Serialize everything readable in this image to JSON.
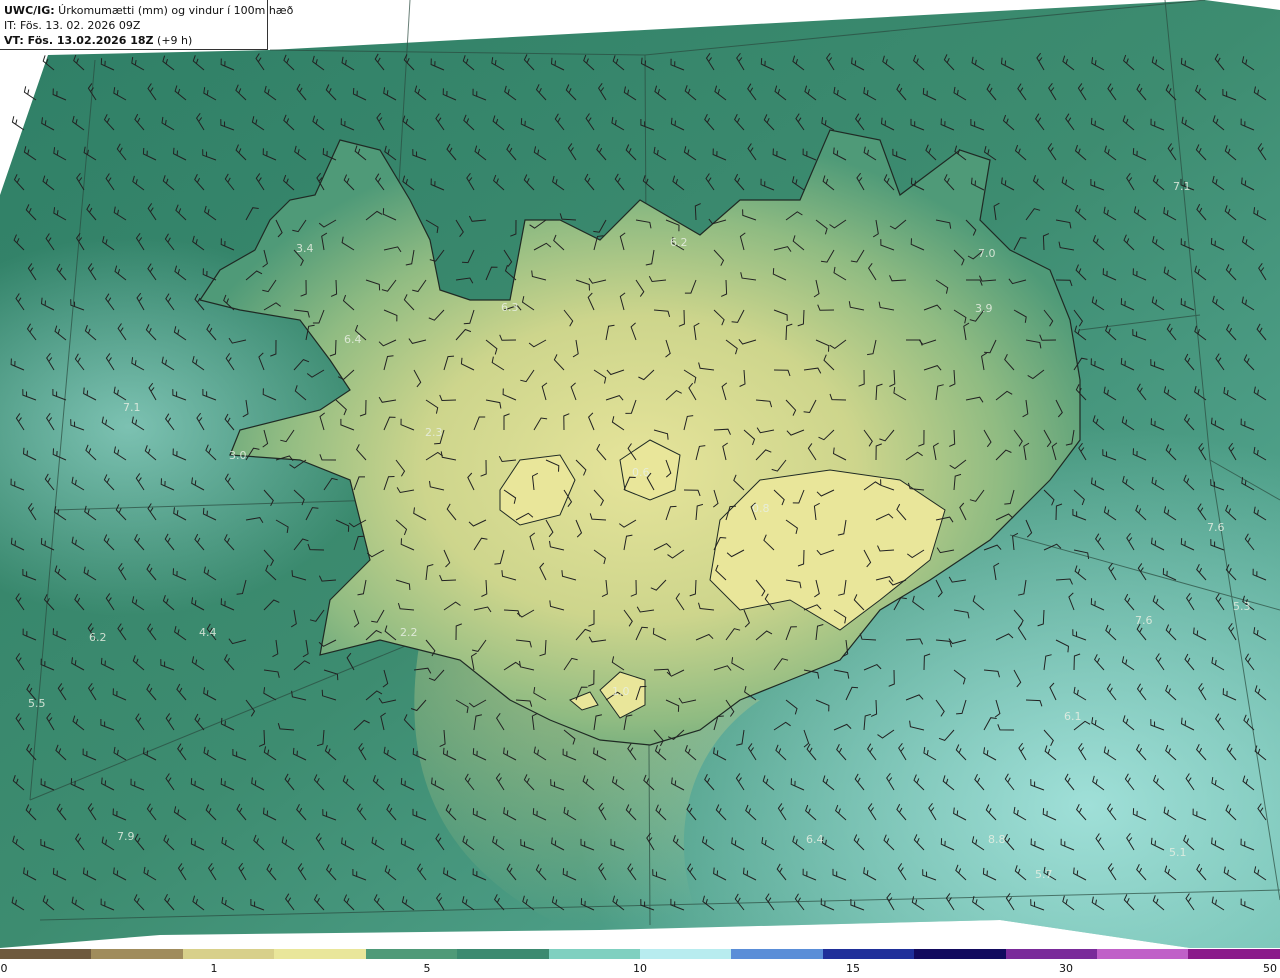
{
  "header": {
    "product_code": "UWC/IG:",
    "product_title": " Úrkomumætti (mm) og vindur í 100m hæð",
    "initial_time": "IT: Fös. 13. 02. 2026 09Z",
    "valid_label": "VT: Fös. 13.02.2026 18Z",
    "lead_time": " (+9 h)"
  },
  "value_labels": [
    "3.4",
    "6.2",
    "7.0",
    "6.3",
    "6.4",
    "7.1",
    "2.3",
    "3.0",
    "0.6",
    "0.8",
    "7.6",
    "5.3",
    "6.2",
    "4.4",
    "2.2",
    "5.5",
    "7.6",
    "6.1",
    "7.9",
    "6.4",
    "8.8",
    "5.7",
    "5.1",
    "7.1",
    "3.9",
    "1.0"
  ],
  "colorbar": {
    "ticks": [
      "0",
      "1",
      "5",
      "10",
      "15",
      "30",
      "50"
    ],
    "colors": [
      "#6e5a3e",
      "#a08c5c",
      "#d8d08a",
      "#e9e69a",
      "#4f9a78",
      "#3b8a70",
      "#7fd0c0",
      "#b8ecef",
      "#5a8ed8",
      "#1f2f9a",
      "#120a5e",
      "#7a2a9a",
      "#c060c8",
      "#8a1a8a"
    ],
    "colors_meaning": "precipitation colour scale, brown→yellow→green→cyan→blue→purple"
  }
}
